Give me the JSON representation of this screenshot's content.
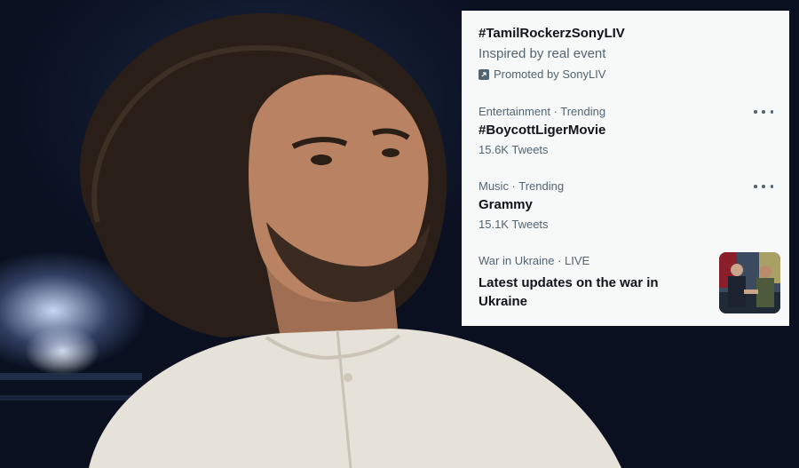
{
  "trends": {
    "promoted": {
      "title": "#TamilRockerzSonyLIV",
      "description": "Inspired by real event",
      "promoted_label": "Promoted by SonyLIV",
      "promoted_icon": "promoted-arrow-icon"
    },
    "items": [
      {
        "context": "Entertainment · Trending",
        "title": "#BoycottLigerMovie",
        "count": "15.6K Tweets"
      },
      {
        "context": "Music · Trending",
        "title": "Grammy",
        "count": "15.1K Tweets"
      },
      {
        "context": "War in Ukraine · LIVE",
        "title": "Latest updates on the war in Ukraine"
      }
    ]
  },
  "colors": {
    "panel_bg": "#f7f9f9",
    "primary_text": "#0f1419",
    "secondary_text": "#536471"
  }
}
